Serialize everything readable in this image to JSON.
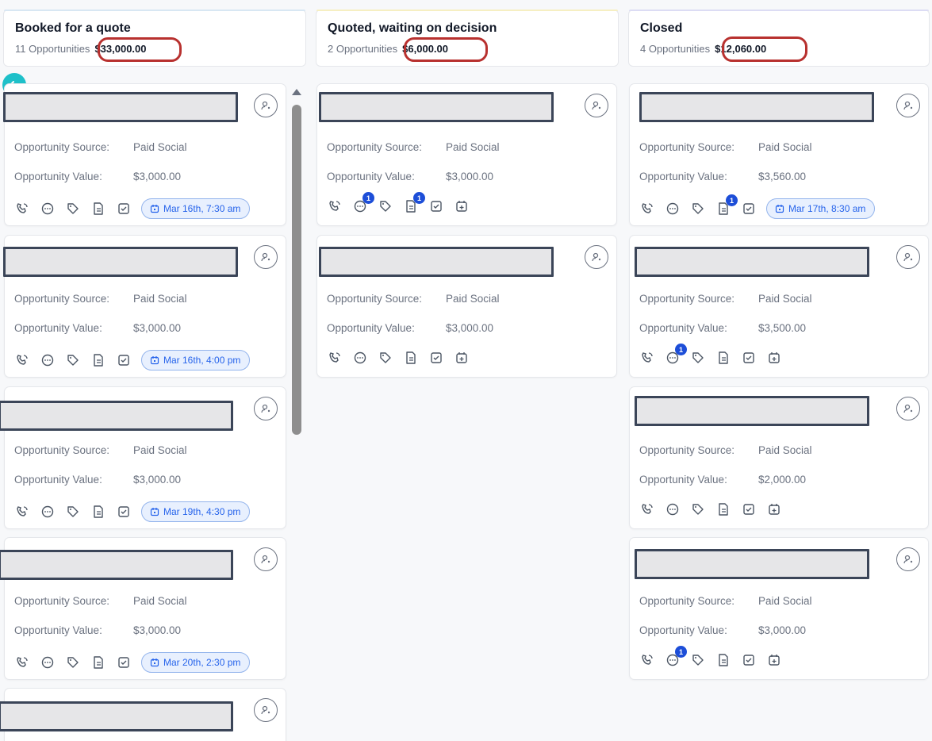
{
  "colors": {
    "ring": "#b8312f",
    "accent": "#2563eb",
    "badge": "#1d4ed8",
    "fab": "#1ec0c9"
  },
  "columns": [
    {
      "title": "Booked for a quote",
      "count": "11 Opportunities",
      "amount": "$33,000.00",
      "accent": "#d8e7f3"
    },
    {
      "title": "Quoted, waiting on decision",
      "count": "2 Opportunities",
      "amount": "$6,000.00",
      "accent": "#f6efc2"
    },
    {
      "title": "Closed",
      "count": "4 Opportunities",
      "amount": "$12,060.00",
      "accent": "#dcdcf4"
    }
  ],
  "labels": {
    "source": "Opportunity Source:",
    "value": "Opportunity Value:"
  },
  "cards": [
    {
      "source": "Paid Social",
      "value": "$3,000.00",
      "appointment": "Mar 16th, 7:30 am"
    },
    {
      "source": "Paid Social",
      "value": "$3,000.00",
      "appointment": "Mar 16th, 4:00 pm"
    },
    {
      "source": "Paid Social",
      "value": "$3,000.00",
      "appointment": "Mar 19th, 4:30 pm"
    },
    {
      "source": "Paid Social",
      "value": "$3,000.00",
      "appointment": "Mar 20th, 2:30 pm"
    },
    {
      "source": "Paid Social",
      "value": "$3,000.00",
      "messages_badge": "1",
      "notes_badge": "1"
    },
    {
      "source": "Paid Social",
      "value": "$3,000.00"
    },
    {
      "source": "Paid Social",
      "value": "$3,560.00",
      "notes_badge": "1",
      "appointment": "Mar 17th, 8:30 am"
    },
    {
      "source": "Paid Social",
      "value": "$3,500.00",
      "messages_badge": "1"
    },
    {
      "source": "Paid Social",
      "value": "$2,000.00"
    },
    {
      "source": "Paid Social",
      "value": "$3,000.00",
      "messages_badge": "1"
    }
  ]
}
